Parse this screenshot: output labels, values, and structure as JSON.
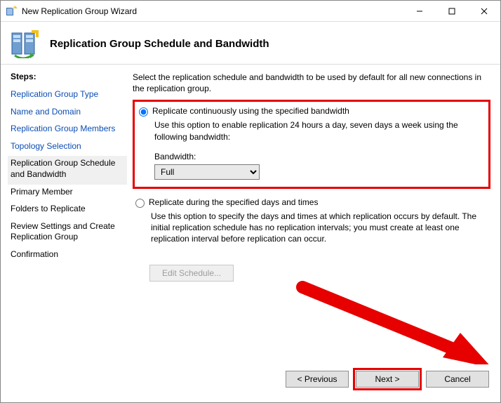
{
  "window": {
    "title": "New Replication Group Wizard"
  },
  "header": {
    "title": "Replication Group Schedule and Bandwidth"
  },
  "steps": {
    "heading": "Steps:",
    "items": [
      {
        "label": "Replication Group Type",
        "state": "link"
      },
      {
        "label": "Name and Domain",
        "state": "link"
      },
      {
        "label": "Replication Group Members",
        "state": "link"
      },
      {
        "label": "Topology Selection",
        "state": "link"
      },
      {
        "label": "Replication Group Schedule and Bandwidth",
        "state": "current"
      },
      {
        "label": "Primary Member",
        "state": "pending"
      },
      {
        "label": "Folders to Replicate",
        "state": "pending"
      },
      {
        "label": "Review Settings and Create Replication Group",
        "state": "pending"
      },
      {
        "label": "Confirmation",
        "state": "pending"
      }
    ]
  },
  "main": {
    "intro": "Select the replication schedule and bandwidth to be used by default for all new connections in the replication group.",
    "option1": {
      "label": "Replicate continuously using the specified bandwidth",
      "desc": "Use this option to enable replication 24 hours a day, seven days a week using the following bandwidth:",
      "bwlabel": "Bandwidth:",
      "bwvalue": "Full",
      "selected": true
    },
    "option2": {
      "label": "Replicate during the specified days and times",
      "desc": "Use this option to specify the days and times at which replication occurs by default. The initial replication schedule has no replication intervals; you must create at least one replication interval before replication can occur.",
      "selected": false
    },
    "editScheduleLabel": "Edit Schedule..."
  },
  "footer": {
    "previous": "< Previous",
    "next": "Next >",
    "cancel": "Cancel"
  }
}
